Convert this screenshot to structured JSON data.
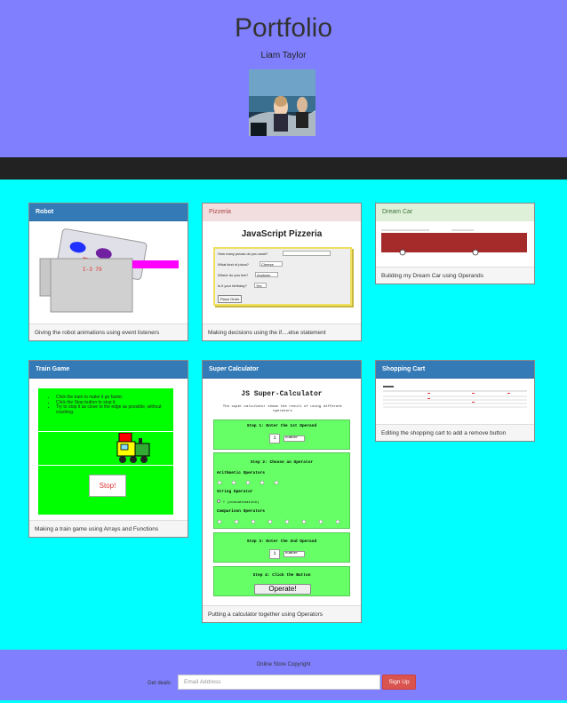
{
  "header": {
    "title": "Portfolio",
    "author": "Liam Taylor"
  },
  "panels": {
    "robot": {
      "title": "Robot",
      "caption": "Giving the robot animations using event listeners",
      "display": "I-3 79"
    },
    "pizzeria": {
      "title": "Pizzeria",
      "caption": "Making decisions using the if....else statement",
      "app_title": "JavaScript Pizzeria",
      "q1": "How many pizzas do you want?",
      "q2": "What kind of pizza?",
      "q2_value": "Cheese",
      "q3": "Where do you live?",
      "q3_value": "Anytown",
      "q4": "Is it your birthday?",
      "q4_value": "Yes",
      "button": "Place Order"
    },
    "dreamcar": {
      "title": "Dream Car",
      "caption": "Building my Dream Car using Operands"
    },
    "train": {
      "title": "Train Game",
      "caption": "Making a train game using Arrays and Functions",
      "instructions": [
        "Click the train to make it go faster.",
        "Click the Stop button to stop it.",
        "Try to stop it as close to the edge as possible, without crashing."
      ],
      "stop_button": "Stop!"
    },
    "calculator": {
      "title": "Super Calculator",
      "caption": "Putting a calculator together using Operators",
      "app_title": "JS Super-Calculator",
      "subtitle": "The super-calculator shows the result of using different operators",
      "step1": "Step 1: Enter the 1st Operand",
      "step1_value": "1",
      "step2": "Step 2: Choose an Operator",
      "arith": "Arithmetic Operators",
      "string_op": "String Operator",
      "concat": "+ (concatenation)",
      "comparison": "Comparison Operators",
      "step3": "Step 3: Enter the 2nd Operand",
      "step3_value": "1",
      "step4": "Step 4: Click the Button",
      "operate": "Operate!",
      "type_option": "number"
    },
    "cart": {
      "title": "Shopping Cart",
      "caption": "Editing the shopping cart to add a remove button"
    }
  },
  "footer": {
    "copyright": "Online Store Copyright",
    "deals_label": "Get deals:",
    "email_placeholder": "Email Address",
    "signup": "Sign Up"
  }
}
